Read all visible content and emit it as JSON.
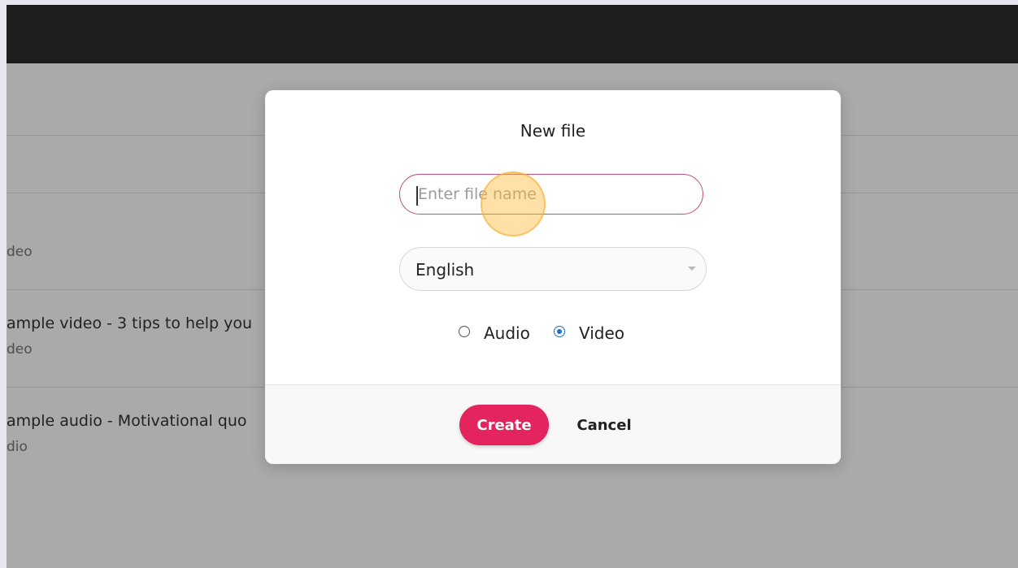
{
  "background_list": {
    "items": [
      {
        "title": "",
        "subtitle": "deo"
      },
      {
        "title": "ample video - 3 tips to help you",
        "subtitle": "deo"
      },
      {
        "title": "ample audio - Motivational quo",
        "subtitle": "dio"
      }
    ]
  },
  "modal": {
    "title": "New file",
    "name_input": {
      "placeholder": "Enter file name",
      "value": ""
    },
    "language_select": {
      "selected": "English"
    },
    "type_radio": {
      "options": [
        {
          "label": "Audio",
          "checked": false
        },
        {
          "label": "Video",
          "checked": true
        }
      ]
    },
    "buttons": {
      "create": "Create",
      "cancel": "Cancel"
    }
  },
  "colors": {
    "accent": "#e3245e",
    "input_border": "#c05075",
    "radio_checked": "#1a6fd8",
    "topbar": "#1e1e1e"
  },
  "icons": [
    "chevron-down-icon",
    "click-indicator"
  ]
}
